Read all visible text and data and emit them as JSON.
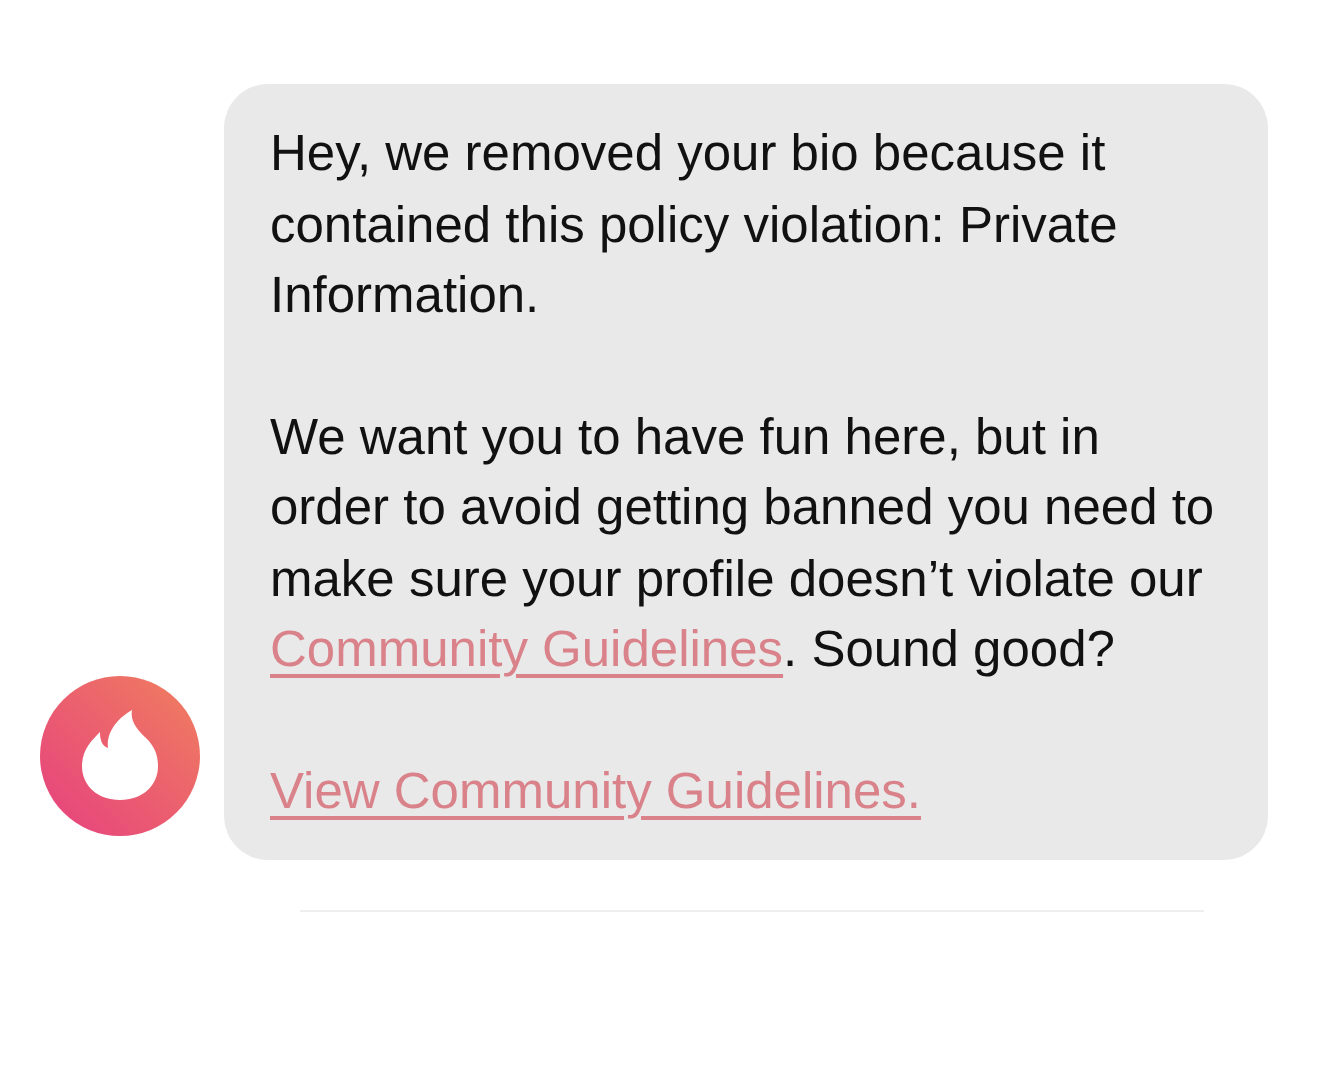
{
  "message": {
    "paragraphs": [
      {
        "text": "Hey, we removed your bio because it contained this policy violation: Private Information."
      },
      {
        "text": "We want you to have fun here, but in order to avoid getting banned you need to make sure your profile doesn’t violate our ",
        "link": "Community Guidelines",
        "after": ". Sound good?"
      }
    ],
    "action_link": "View Community Guidelines."
  }
}
